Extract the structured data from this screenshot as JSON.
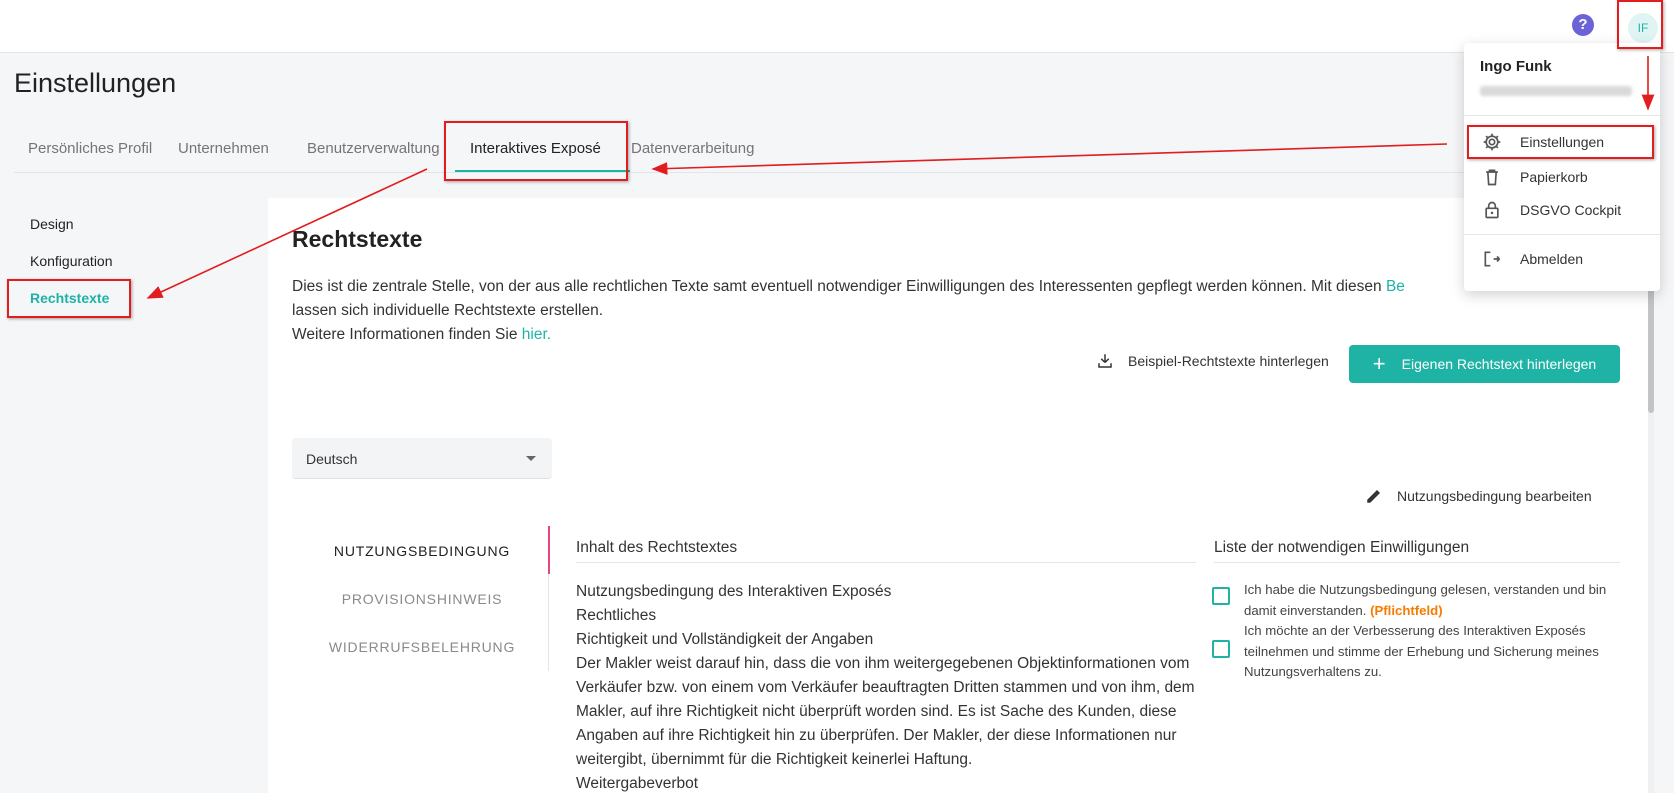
{
  "header": {
    "help_icon": "help-icon",
    "avatar_initials": "IF"
  },
  "page": {
    "title": "Einstellungen"
  },
  "tabs": [
    {
      "label": "Persönliches Profil",
      "active": false
    },
    {
      "label": "Unternehmen",
      "active": false
    },
    {
      "label": "Benutzerverwaltung",
      "active": false
    },
    {
      "label": "Interaktives Exposé",
      "active": true
    },
    {
      "label": "Datenverarbeitung",
      "active": false
    }
  ],
  "subnav": [
    {
      "label": "Design",
      "active": false
    },
    {
      "label": "Konfiguration",
      "active": false
    },
    {
      "label": "Rechtstexte",
      "active": true
    }
  ],
  "section": {
    "title": "Rechtstexte",
    "description_part1": "Dies ist die zentrale Stelle, von der aus alle rechtlichen Texte samt eventuell notwendiger Einwilligungen des Interessenten gepflegt werden können. Mit diesen ",
    "description_link": "Be",
    "description_part2": "lassen sich individuelle Rechtstexte erstellen.",
    "info_prefix": "Weitere Informationen finden Sie ",
    "info_link": "hier."
  },
  "actions": {
    "sample_label": "Beispiel-Rechtstexte hinterlegen",
    "own_label": "Eigenen Rechtstext hinterlegen",
    "edit_label": "Nutzungsbedingung bearbeiten"
  },
  "language_select": {
    "value": "Deutsch"
  },
  "legal_tabs": [
    {
      "label": "NUTZUNGSBEDINGUNG",
      "active": true
    },
    {
      "label": "PROVISIONSHINWEIS",
      "active": false
    },
    {
      "label": "WIDERRUFSBELEHRUNG",
      "active": false
    }
  ],
  "content": {
    "column_title": "Inhalt des Rechtstextes",
    "lines": [
      "Nutzungsbedingung des Interaktiven Exposés",
      "Rechtliches",
      "Richtigkeit und Vollständigkeit der Angaben",
      "Der Makler weist darauf hin, dass die von ihm weitergegebenen Objektinformationen vom Verkäufer bzw. von einem vom Verkäufer beauftragten Dritten stammen und von ihm, dem Makler, auf ihre Richtigkeit nicht überprüft worden sind. Es ist Sache des Kunden, diese Angaben auf ihre Richtigkeit hin zu überprüfen. Der Makler, der diese Informationen nur weitergibt, übernimmt für die Richtigkeit keinerlei Haftung.",
      "Weitergabeverbot"
    ]
  },
  "consents": {
    "column_title": "Liste der notwendigen Einwilligungen",
    "items": [
      {
        "text": "Ich habe die Nutzungsbedingung gelesen, verstanden und bin damit einverstanden. ",
        "badge": "(Pflichtfeld)"
      },
      {
        "text": "Ich möchte an der Verbesserung des Interaktiven Exposés teilnehmen und stimme der Erhebung und Sicherung meines Nutzungsverhaltens zu.",
        "badge": ""
      }
    ]
  },
  "user_menu": {
    "name": "Ingo Funk",
    "items": [
      {
        "label": "Einstellungen",
        "icon": "gear-icon"
      },
      {
        "label": "Papierkorb",
        "icon": "trash-icon"
      },
      {
        "label": "DSGVO Cockpit",
        "icon": "lock-icon"
      },
      {
        "label": "Abmelden",
        "icon": "logout-icon"
      }
    ]
  },
  "colors": {
    "accent": "#1fb3a6",
    "annotation": "#e11d1d",
    "required": "#f57c00"
  }
}
